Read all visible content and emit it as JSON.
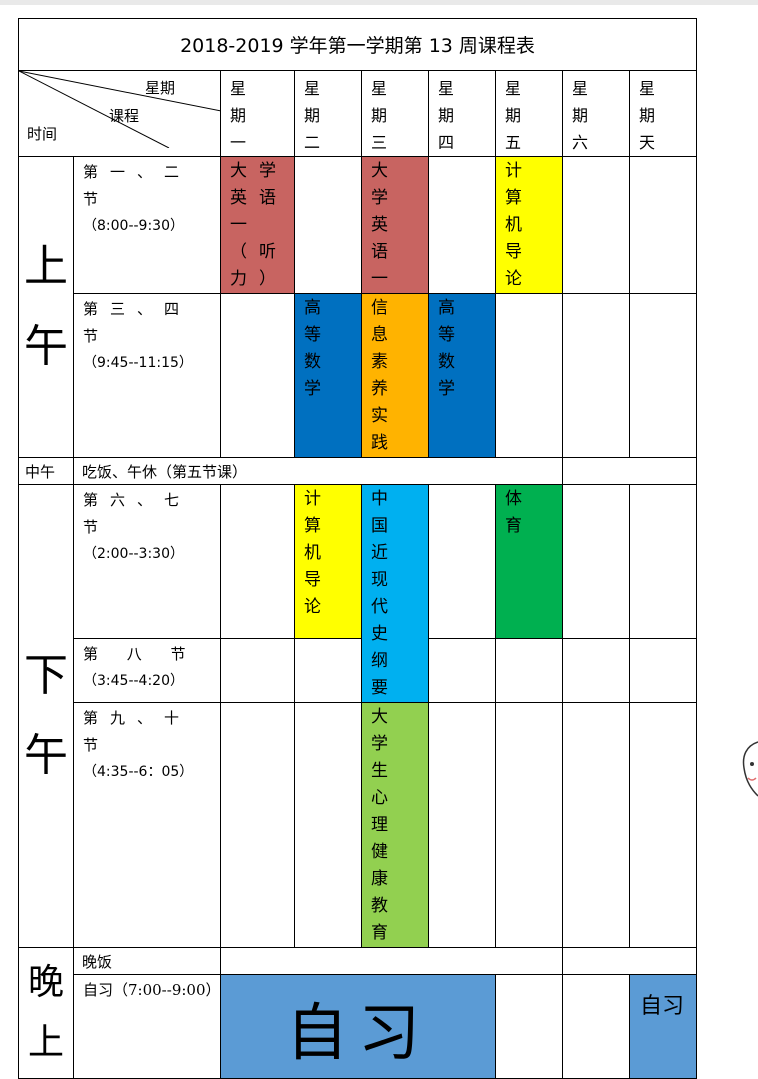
{
  "title": "2018-2019 学年第一学期第 13 周课程表",
  "header": {
    "weekday_label": "星期",
    "course_label": "课程",
    "time_label": "时间"
  },
  "days": [
    "星 期 一",
    "星 期 二",
    "星 期 三",
    "星 期 四",
    "星 期 五",
    "星 期 六",
    "星 期 天"
  ],
  "sections": {
    "morning": "上午",
    "noon": "中午",
    "afternoon": "下午",
    "evening": "晚上"
  },
  "periods": {
    "p12_name": "第一、二节",
    "p12_time": "（8:00--9:30）",
    "p34_name": "第三、四节",
    "p34_time": "（9:45--11:15）",
    "noon_text": "吃饭、午休（第五节课）",
    "p67_name": "第六、七节",
    "p67_time": "（2:00--3:30）",
    "p8_name": "第 八 节",
    "p8_time": "（3:45--4:20）",
    "p910_name": "第九、十节",
    "p910_time": "（4:35--6：05）",
    "dinner": "晚饭",
    "self_study_time": "自习（7:00--9:00）"
  },
  "courses": {
    "mon_12": "大学英语一（听力）",
    "wed_12": "大学英语一",
    "fri_12": "计算机导论",
    "tue_34": "高等数学",
    "wed_34": "信息素养实践",
    "thu_34": "高等数学",
    "tue_67": "计算机导论",
    "wed_678": "中国近现代史纲要",
    "fri_67": "体育",
    "wed_910": "大学生心理健康教育",
    "self_big": "自习",
    "self_sun": "自习"
  },
  "colors": {
    "red": "#c86461",
    "yellow": "#ffff00",
    "blue": "#0070c0",
    "orange": "#ffb300",
    "cyan": "#00b0f0",
    "green": "#00b050",
    "light_green": "#92d050",
    "steel_blue": "#5b9bd5"
  }
}
